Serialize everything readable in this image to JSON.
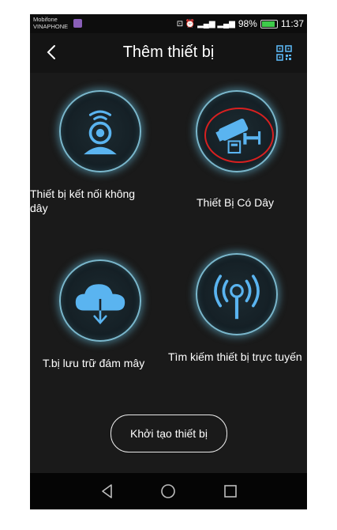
{
  "status": {
    "carrier_line1": "Mobifone",
    "carrier_line2": "VINAPHONE",
    "icons": "⊡ ⏰ ▂▄▆ ▂▄▆",
    "battery_pct": "98%",
    "time": "11:37"
  },
  "header": {
    "title": "Thêm thiết bị",
    "back_icon": "chevron-left-icon",
    "qr_icon": "qr-scan-icon"
  },
  "options": [
    {
      "label": "Thiết bị kết nối không dây",
      "icon": "wifi-camera-icon"
    },
    {
      "label": "Thiết Bị Có Dây",
      "icon": "wired-camera-icon"
    },
    {
      "label": "T.bị lưu trữ đám mây",
      "icon": "cloud-download-icon"
    },
    {
      "label": "Tìm kiếm thiết bị trực tuyến",
      "icon": "broadcast-signal-icon"
    }
  ],
  "create_button": "Khởi tạo thiết bị",
  "colors": {
    "accent": "#7ab7cc",
    "icon": "#5ab4f0",
    "highlight": "#d82020"
  }
}
